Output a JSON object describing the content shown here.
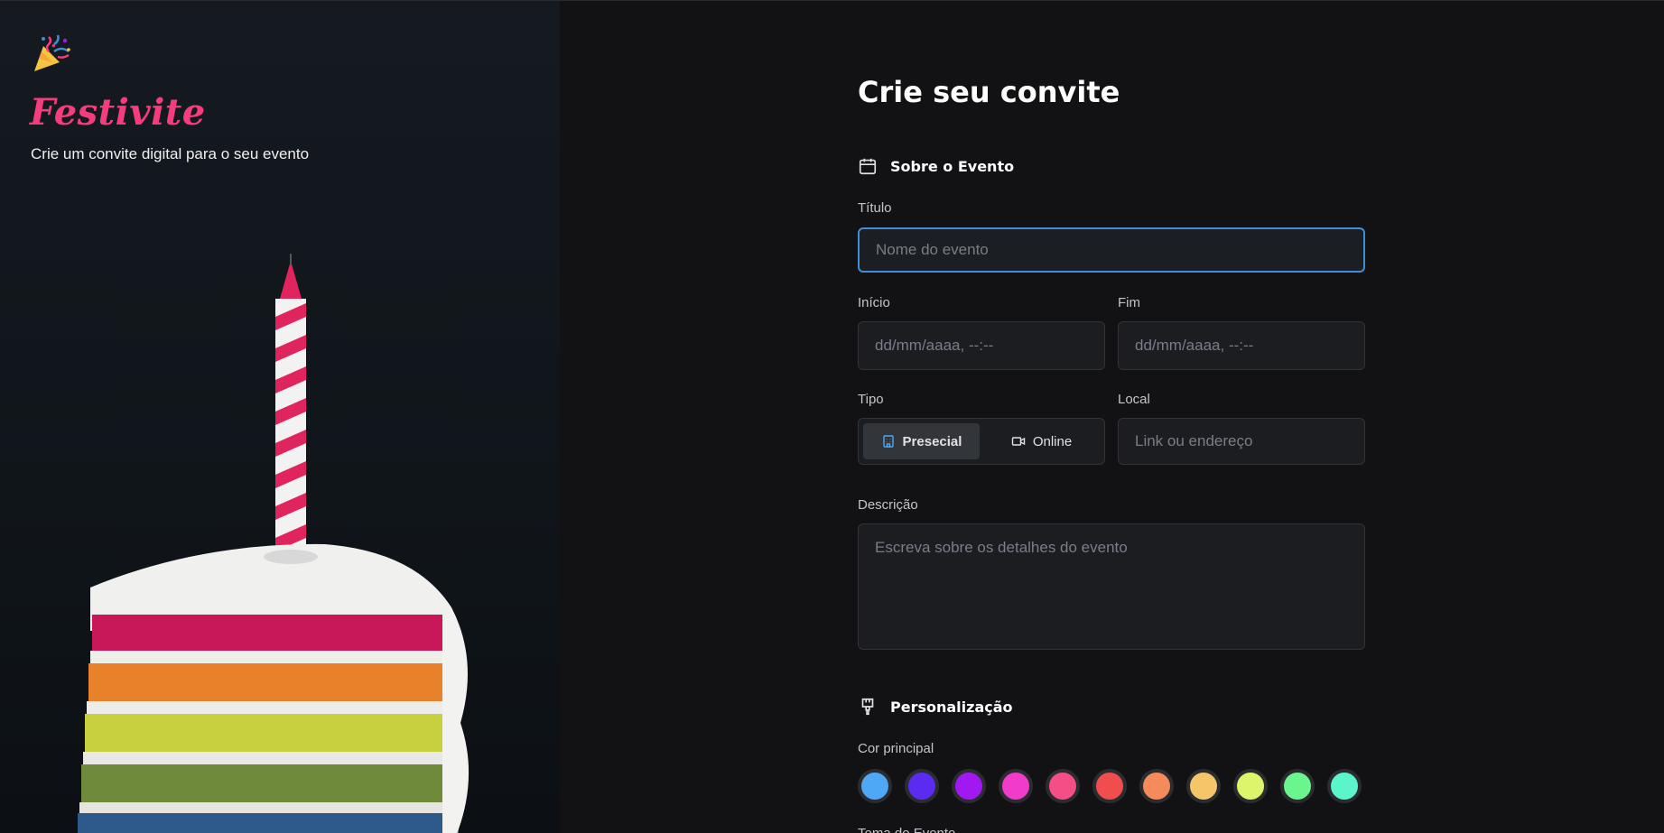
{
  "brand": {
    "name": "Festivite",
    "tagline": "Crie um convite digital para o seu evento"
  },
  "form": {
    "title": "Crie seu convite",
    "section_event": "Sobre o Evento",
    "titulo_label": "Título",
    "titulo_placeholder": "Nome do evento",
    "inicio_label": "Início",
    "inicio_placeholder": "dd/mm/aaaa, --:--",
    "fim_label": "Fim",
    "fim_placeholder": "dd/mm/aaaa, --:--",
    "tipo_label": "Tipo",
    "tipo_options": [
      "Presecial",
      "Online"
    ],
    "tipo_selected": "Presecial",
    "local_label": "Local",
    "local_placeholder": "Link ou endereço",
    "descricao_label": "Descrição",
    "descricao_placeholder": "Escreva sobre os detalhes do evento",
    "section_custom": "Personalização",
    "cor_label": "Cor principal",
    "tema_label": "Tema do Evento"
  },
  "colors": {
    "accent": "#f53d7d",
    "focus": "#3f8fd6",
    "swatches": [
      "#4ea8f5",
      "#5b2bf0",
      "#a218f0",
      "#f03cc8",
      "#f54d85",
      "#f04e4e",
      "#f58a5a",
      "#f5c56a",
      "#ddf56a",
      "#6af58e",
      "#5af5c8"
    ]
  }
}
